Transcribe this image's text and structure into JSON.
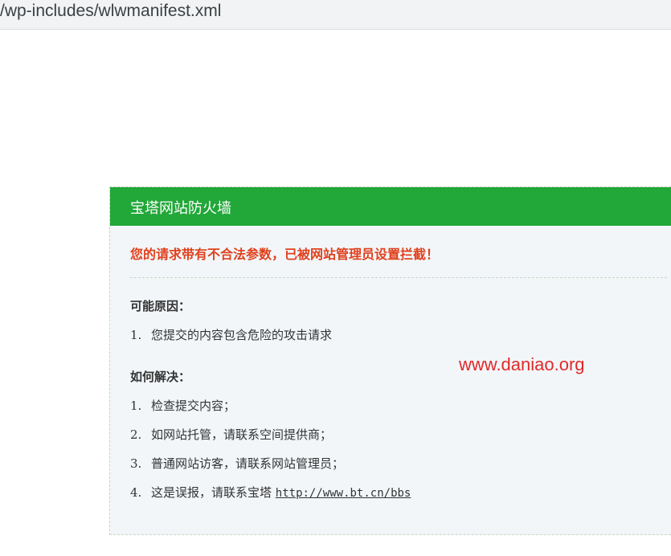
{
  "address_bar": {
    "url": "/wp-includes/wlwmanifest.xml"
  },
  "firewall": {
    "title": "宝塔网站防火墙",
    "alert": "您的请求带有不合法参数，已被网站管理员设置拦截！",
    "reasons_title": "可能原因：",
    "reasons": [
      {
        "num": "1.",
        "text": "您提交的内容包含危险的攻击请求"
      }
    ],
    "solutions_title": "如何解决：",
    "solutions": [
      {
        "num": "1.",
        "text": "检查提交内容；"
      },
      {
        "num": "2.",
        "text": "如网站托管，请联系空间提供商；"
      },
      {
        "num": "3.",
        "text": "普通网站访客，请联系网站管理员；"
      },
      {
        "num": "4.",
        "text": "这是误报，请联系宝塔 ",
        "link": "http://www.bt.cn/bbs"
      }
    ]
  },
  "watermark": "www.daniao.org",
  "colors": {
    "header_green": "#22a739",
    "alert_red": "#e0401c",
    "watermark_red": "#e02a2a"
  }
}
